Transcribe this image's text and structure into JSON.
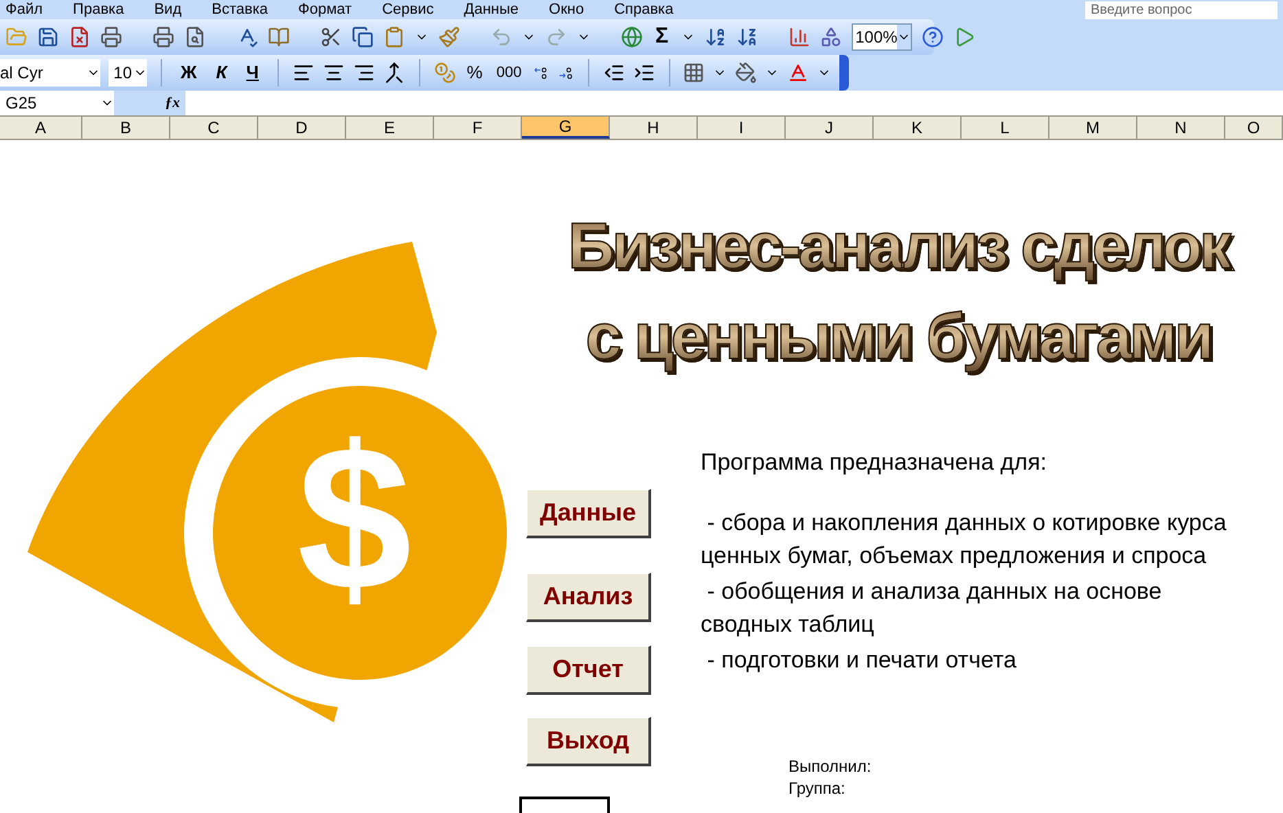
{
  "menu": [
    "Файл",
    "Правка",
    "Вид",
    "Вставка",
    "Формат",
    "Сервис",
    "Данные",
    "Окно",
    "Справка"
  ],
  "question_box": {
    "placeholder": "Введите вопрос"
  },
  "standard_toolbar": {
    "autosum": "Σ",
    "zoom": "100%"
  },
  "formatting_toolbar": {
    "font": "al Cyr",
    "size": "10",
    "bold": "Ж",
    "italic": "К",
    "underline": "Ч",
    "percent": "%",
    "thousands": "000"
  },
  "formula_bar": {
    "name_box": "G25",
    "function_label": "ƒx"
  },
  "columns": [
    {
      "label": "A",
      "selected": false
    },
    {
      "label": "B",
      "selected": false
    },
    {
      "label": "C",
      "selected": false
    },
    {
      "label": "D",
      "selected": false
    },
    {
      "label": "E",
      "selected": false
    },
    {
      "label": "F",
      "selected": false
    },
    {
      "label": "G",
      "selected": true
    },
    {
      "label": "H",
      "selected": false
    },
    {
      "label": "I",
      "selected": false
    },
    {
      "label": "J",
      "selected": false
    },
    {
      "label": "K",
      "selected": false
    },
    {
      "label": "L",
      "selected": false
    },
    {
      "label": "M",
      "selected": false
    },
    {
      "label": "N",
      "selected": false
    },
    {
      "label": "O",
      "selected": false
    }
  ],
  "logo": {
    "symbol": "$"
  },
  "title": [
    "Бизнес-анализ сделок",
    "с ценными бумагами"
  ],
  "buttons": [
    "Данные",
    "Анализ",
    "Отчет",
    "Выход"
  ],
  "description": {
    "heading": "Программа предназначена для:",
    "items": [
      " - сбора и накопления данных о котировке курса ценных бумаг, объемах предложения и спроса",
      " - обобщения и анализа данных на основе сводных таблиц",
      " - подготовки и печати отчета"
    ]
  },
  "author": [
    "Выполнил:",
    "Группа:"
  ]
}
